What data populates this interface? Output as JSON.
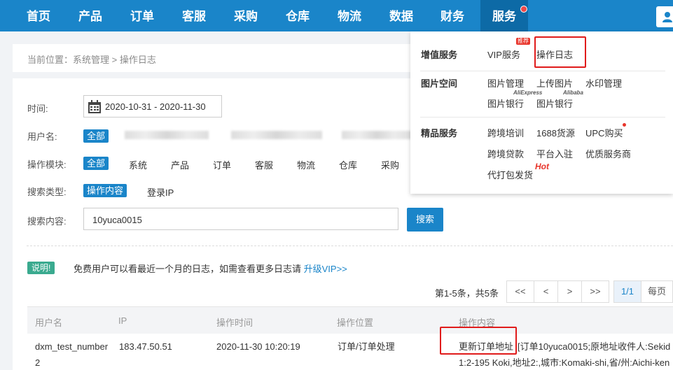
{
  "nav": {
    "items": [
      "首页",
      "产品",
      "订单",
      "客服",
      "采购",
      "仓库",
      "物流",
      "数据",
      "财务",
      "服务"
    ]
  },
  "breadcrumb": {
    "text": "当前位置：系统管理 > 操作日志"
  },
  "filters": {
    "time_label": "时间:",
    "time_value": "2020-10-31 - 2020-11-30",
    "user_label": "用户名:",
    "user_all": "全部",
    "module_label": "操作模块:",
    "module_all": "全部",
    "modules": [
      "系统",
      "产品",
      "订单",
      "客服",
      "物流",
      "仓库",
      "采购"
    ],
    "search_type_label": "搜索类型:",
    "search_type_active": "操作内容",
    "search_type_other": "登录IP",
    "search_content_label": "搜索内容:",
    "search_value": "10yuca0015",
    "search_button": "搜索"
  },
  "notice": {
    "badge": "说明!",
    "text": "免费用户可以看最近一个月的日志，如需查看更多日志请",
    "link": "升级VIP>>"
  },
  "pager": {
    "info": "第1-5条，共5条",
    "first": "<<",
    "prev": "<",
    "next": ">",
    "last": ">>",
    "current": "1/1",
    "per_page": "每页"
  },
  "table": {
    "headers": [
      "用户名",
      "IP",
      "操作时间",
      "操作位置",
      "操作内容"
    ],
    "rows": [
      {
        "user_line1": "dxm_test_number",
        "user_line2": "2",
        "ip": "183.47.50.51",
        "time": "2020-11-30 10:20:19",
        "location": "订单/订单处理",
        "action": "更新订单地址",
        "detail_line1": "[订单10yuca0015;原地址收件人:Sekid",
        "detail_line2": "1:2-195 Koki,地址2:,城市:Komaki-shi,省/州:Aichi-ken"
      }
    ]
  },
  "services_menu": {
    "sections": [
      {
        "title": "增值服务",
        "items": [
          "VIP服务",
          "操作日志"
        ],
        "badge": "推荐"
      },
      {
        "title": "图片空间",
        "items": [
          "图片管理",
          "上传图片",
          "水印管理",
          "图片银行",
          "图片银行"
        ],
        "tags": [
          "AliExpress",
          "Alibaba"
        ]
      },
      {
        "title": "精品服务",
        "items": [
          "跨境培训",
          "1688货源",
          "UPC购买",
          "跨境贷款",
          "平台入驻",
          "优质服务商",
          "代打包发货"
        ],
        "hot": "Hot"
      }
    ]
  }
}
